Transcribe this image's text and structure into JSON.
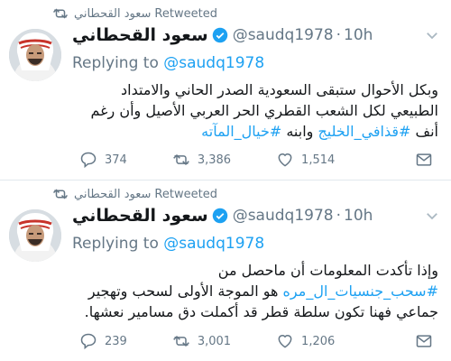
{
  "tweets": [
    {
      "retweeter": "سعود القحطاني",
      "retweeted_label": "Retweeted",
      "name": "سعود القحطاني",
      "handle": "@saudq1978",
      "dot": "·",
      "time": "10h",
      "replying_prefix": "Replying to ",
      "replying_to": "@saudq1978",
      "lines": [
        "وبكل الأحوال ستبقى السعودية الصدر الحاني والامتداد",
        "الطبيعي لكل الشعب القطري الحر  العربي الأصيل وأن رغم"
      ],
      "line3_start": "أنف ",
      "hashtag1": "#قذافي_الخليج",
      "line3_mid": " وابنه ",
      "hashtag2": "#خيال_المآته",
      "reply_count": "374",
      "retweet_count": "3,386",
      "like_count": "1,514"
    },
    {
      "retweeter": "سعود القحطاني",
      "retweeted_label": "Retweeted",
      "name": "سعود القحطاني",
      "handle": "@saudq1978",
      "dot": "·",
      "time": "10h",
      "replying_prefix": "Replying to ",
      "replying_to": "@saudq1978",
      "line1": "وإذا تأكدت المعلومات أن ماحصل من",
      "hashtag": "#سحب_جنسيات_ال_مره",
      "line2_rest": " هو الموجة الأولى لسحب وتهجير",
      "line3": "جماعي فهنا تكون سلطة قطر قد أكملت دق مسامير نعشها.",
      "reply_count": "239",
      "retweet_count": "3,001",
      "like_count": "1,206"
    }
  ],
  "colors": {
    "accent": "#1da1f2",
    "muted": "#657786",
    "text": "#14171a"
  },
  "icons": [
    "retweet-icon",
    "verified-badge-icon",
    "chevron-down-icon",
    "reply-icon",
    "like-icon",
    "direct-message-icon"
  ]
}
